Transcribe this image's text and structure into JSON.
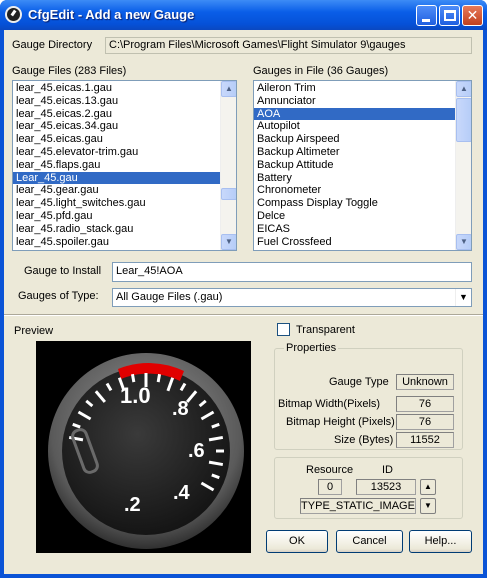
{
  "window": {
    "title": "CfgEdit - Add a new Gauge"
  },
  "gauge_directory": {
    "label": "Gauge Directory",
    "value": "C:\\Program Files\\Microsoft Games\\Flight Simulator 9\\gauges"
  },
  "gauge_files": {
    "label": "Gauge Files  (283 Files)",
    "items": [
      "lear_45.eicas.1.gau",
      "lear_45.eicas.13.gau",
      "lear_45.eicas.2.gau",
      "lear_45.eicas.34.gau",
      "lear_45.eicas.gau",
      "lear_45.elevator-trim.gau",
      "lear_45.flaps.gau",
      "Lear_45.gau",
      "lear_45.gear.gau",
      "lear_45.light_switches.gau",
      "lear_45.pfd.gau",
      "lear_45.radio_stack.gau",
      "lear_45.spoiler.gau"
    ],
    "selected": 7
  },
  "gauges_in_file": {
    "label": "Gauges in File  (36 Gauges)",
    "items": [
      "Aileron Trim",
      "Annunciator",
      "AOA",
      "Autopilot",
      "Backup Airspeed",
      "Backup Altimeter",
      "Backup Attitude",
      "Battery",
      "Chronometer",
      "Compass Display Toggle",
      "Delce",
      "EICAS",
      "Fuel Crossfeed"
    ],
    "selected": 2
  },
  "gauge_to_install": {
    "label": "Gauge to Install",
    "value": "Lear_45!AOA"
  },
  "gauges_of_type": {
    "label": "Gauges of Type:",
    "value": "All Gauge Files (.gau)"
  },
  "preview": {
    "label": "Preview",
    "dial_labels": [
      "1.0",
      ".8",
      ".6",
      ".4",
      ".2"
    ]
  },
  "transparent": {
    "label": "Transparent",
    "checked": false
  },
  "properties": {
    "label": "Properties",
    "gauge_type_label": "Gauge Type",
    "gauge_type": "Unknown",
    "bitmap_width_label": "Bitmap Width(Pixels)",
    "bitmap_width": "76",
    "bitmap_height_label": "Bitmap Height (Pixels)",
    "bitmap_height": "76",
    "size_label": "Size (Bytes)",
    "size": "11552"
  },
  "resource": {
    "label": "Resource",
    "id_label": "ID",
    "resource_value": "0",
    "id_value": "13523",
    "type_value": "TYPE_STATIC_IMAGE"
  },
  "buttons": {
    "ok": "OK",
    "cancel": "Cancel",
    "help": "Help..."
  }
}
